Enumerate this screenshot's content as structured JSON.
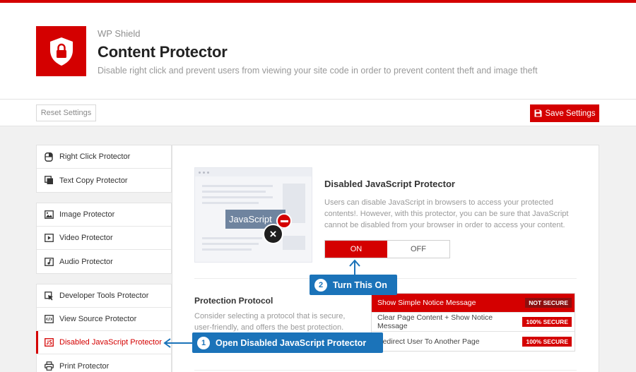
{
  "header": {
    "brand": "WP Shield",
    "title": "Content Protector",
    "subtitle": "Disable right click and prevent users from viewing your site code in order to prevent content theft and image theft"
  },
  "toolbar": {
    "reset_label": "Reset Settings",
    "save_label": "Save Settings"
  },
  "sidebar": {
    "groups": [
      {
        "items": [
          {
            "label": "Right Click Protector",
            "icon": "mouse-icon"
          },
          {
            "label": "Text Copy Protector",
            "icon": "copy-icon"
          }
        ]
      },
      {
        "items": [
          {
            "label": "Image Protector",
            "icon": "image-icon"
          },
          {
            "label": "Video Protector",
            "icon": "video-icon"
          },
          {
            "label": "Audio Protector",
            "icon": "audio-icon"
          }
        ]
      },
      {
        "items": [
          {
            "label": "Developer Tools Protector",
            "icon": "cursor-icon"
          },
          {
            "label": "View Source Protector",
            "icon": "code-icon"
          },
          {
            "label": "Disabled JavaScript Protector",
            "icon": "js-icon",
            "active": true
          },
          {
            "label": "Print Protector",
            "icon": "printer-icon"
          }
        ]
      }
    ]
  },
  "illustration": {
    "label": "JavaScript"
  },
  "feature": {
    "title": "Disabled JavaScript Protector",
    "description": "Users can disable JavaScript in browsers to access your protected contents!. However, with this protector, you can be sure that JavaScript cannot be disabled from your browser in order to access your content.",
    "toggle_on": "ON",
    "toggle_off": "OFF",
    "toggle_state": "on"
  },
  "protocol": {
    "title": "Protection Protocol",
    "description": "Consider selecting a protocol that is secure, user-friendly, and offers the best protection.",
    "options": [
      {
        "label": "Show Simple Notice Message",
        "tag": "NOT SECURE",
        "selected": true
      },
      {
        "label": "Clear Page Content + Show Notice Message",
        "tag": "100% SECURE"
      },
      {
        "label": "Redirect User To Another Page",
        "tag": "100% SECURE"
      }
    ]
  },
  "callouts": [
    {
      "number": "1",
      "text": "Open Disabled JavaScript Protector"
    },
    {
      "number": "2",
      "text": "Turn This On"
    }
  ],
  "colors": {
    "accent": "#d40000",
    "callout": "#1b73b9"
  }
}
